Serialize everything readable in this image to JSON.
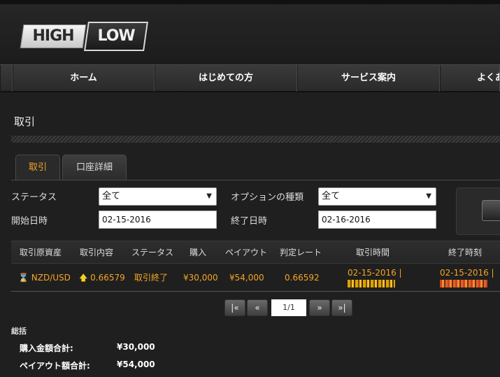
{
  "logo": {
    "high": "HIGH",
    "low": "LOW"
  },
  "nav": {
    "items": [
      "ホーム",
      "はじめての方",
      "サービス案内",
      "よくあ"
    ]
  },
  "page": {
    "title": "取引"
  },
  "tabs": [
    {
      "label": "取引",
      "active": true
    },
    {
      "label": "口座詳細",
      "active": false
    }
  ],
  "filters": {
    "status_label": "ステータス",
    "status_value": "全て",
    "option_type_label": "オプションの種類",
    "option_type_value": "全て",
    "start_label": "開始日時",
    "start_value": "02-15-2016",
    "end_label": "終了日時",
    "end_value": "02-16-2016"
  },
  "table": {
    "headers": [
      "取引原資産",
      "取引内容",
      "ステータス",
      "購入",
      "ペイアウト",
      "判定レート",
      "取引時間",
      "終了時刻"
    ],
    "rows": [
      {
        "asset": "NZD/USD",
        "content": "0.66579",
        "status": "取引終了",
        "purchase": "¥30,000",
        "payout": "¥54,000",
        "rate": "0.66592",
        "trade_time": "02-15-2016 |",
        "end_time": "02-15-2016 |"
      }
    ]
  },
  "pagination": {
    "first": "|«",
    "prev": "«",
    "current": "1/1",
    "next": "»",
    "last": "»|"
  },
  "summary": {
    "title": "総括",
    "purchase_total_label": "購入金額合計:",
    "purchase_total_value": "¥30,000",
    "payout_total_label": "ペイアウト額合計:",
    "payout_total_value": "¥54,000"
  },
  "colors": {
    "accent": "#f5a623",
    "background": "#1f1f1f"
  }
}
